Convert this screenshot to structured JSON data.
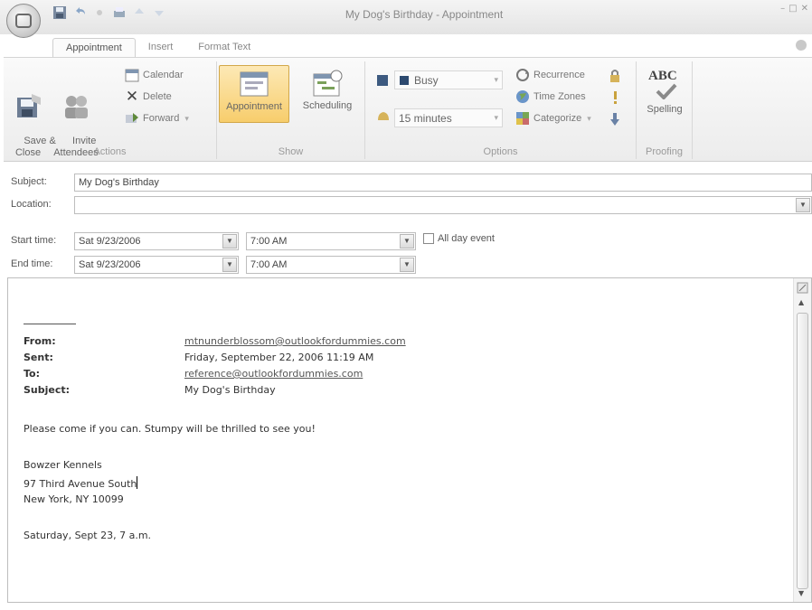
{
  "window": {
    "title": "My Dog's Birthday - Appointment",
    "minimize": "–",
    "maximize": "□",
    "close": "✕"
  },
  "quick_access_icons": [
    "save-icon",
    "undo-icon",
    "redo-icon",
    "print-icon",
    "up-arrow-icon",
    "down-arrow-icon"
  ],
  "tabs": [
    {
      "label": "Appointment",
      "active": true
    },
    {
      "label": "Insert",
      "active": false
    },
    {
      "label": "Format Text",
      "active": false
    }
  ],
  "ribbon": {
    "actions": {
      "group_label": "Actions",
      "save_close": "Save &\nClose",
      "invite": "Invite\nAttendees",
      "calendar": "Calendar",
      "delete": "Delete",
      "forward": "Forward"
    },
    "show": {
      "group_label": "Show",
      "appointment": "Appointment",
      "scheduling": "Scheduling"
    },
    "options": {
      "group_label": "Options",
      "show_as": "Busy",
      "reminder": "15 minutes",
      "recurrence": "Recurrence",
      "time_zones": "Time Zones",
      "categorize": "Categorize"
    },
    "proofing": {
      "group_label": "Proofing",
      "spelling": "Spelling",
      "abc_text": "ABC"
    }
  },
  "form": {
    "subject_label": "Subject:",
    "subject_value": "My Dog's Birthday",
    "location_label": "Location:",
    "location_value": "",
    "start_label": "Start time:",
    "start_date": "Sat 9/23/2006",
    "start_time": "7:00 AM",
    "end_label": "End time:",
    "end_date": "Sat 9/23/2006",
    "end_time": "7:00 AM",
    "all_day_label": "All day event",
    "all_day_checked": false
  },
  "message": {
    "from_key": "From:",
    "from_val": "mtnunderblossom@outlookfordummies.com",
    "sent_key": "Sent:",
    "sent_val": "Friday, September 22, 2006 11:19 AM",
    "to_key": "To:",
    "to_val": "reference@outlookfordummies.com",
    "subject_key": "Subject:",
    "subject_val": "My Dog's Birthday",
    "body_line1": "Please come if you can. Stumpy will be thrilled to see you!",
    "address1": "Bowzer Kennels",
    "address2": "97 Third Avenue South",
    "address3": "New York, NY 10099",
    "date_line": "Saturday, Sept 23, 7 a.m."
  }
}
